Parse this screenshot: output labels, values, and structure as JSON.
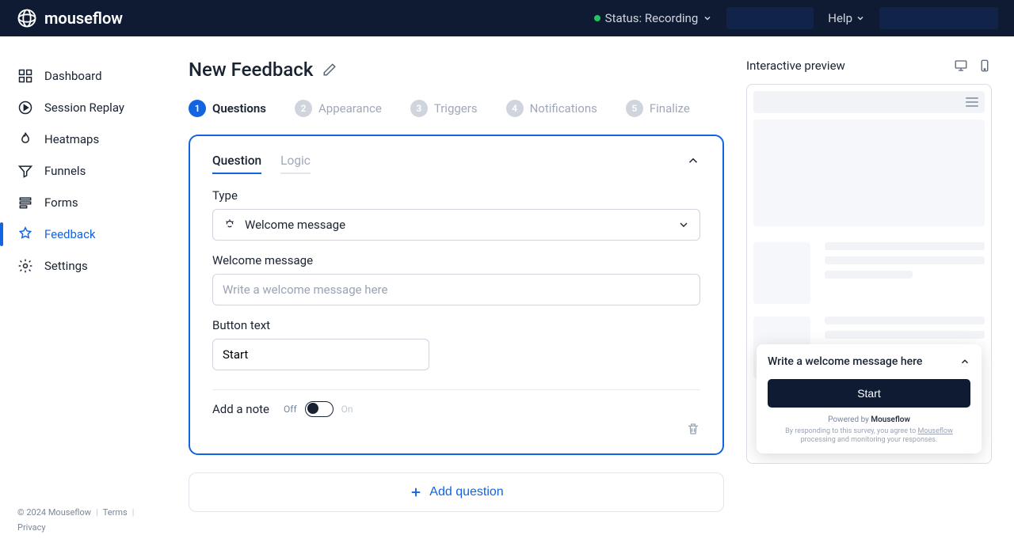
{
  "brand": "mouseflow",
  "topbar": {
    "status_label": "Status: Recording",
    "help_label": "Help"
  },
  "sidebar": {
    "items": [
      {
        "label": "Dashboard"
      },
      {
        "label": "Session Replay"
      },
      {
        "label": "Heatmaps"
      },
      {
        "label": "Funnels"
      },
      {
        "label": "Forms"
      },
      {
        "label": "Feedback"
      },
      {
        "label": "Settings"
      }
    ],
    "footer": {
      "copyright": "© 2024 Mouseflow",
      "terms": "Terms",
      "privacy": "Privacy"
    }
  },
  "page": {
    "title": "New Feedback",
    "steps": [
      {
        "num": "1",
        "label": "Questions"
      },
      {
        "num": "2",
        "label": "Appearance"
      },
      {
        "num": "3",
        "label": "Triggers"
      },
      {
        "num": "4",
        "label": "Notifications"
      },
      {
        "num": "5",
        "label": "Finalize"
      }
    ]
  },
  "card": {
    "tabs": {
      "question": "Question",
      "logic": "Logic"
    },
    "type_label": "Type",
    "type_value": "Welcome message",
    "welcome_label": "Welcome message",
    "welcome_placeholder": "Write a welcome message here",
    "button_label": "Button text",
    "button_value": "Start",
    "note_label": "Add a note",
    "toggle_off": "Off",
    "toggle_on": "On"
  },
  "add_question_label": "Add question",
  "preview": {
    "title": "Interactive preview",
    "popup_title": "Write a welcome message here",
    "popup_button": "Start",
    "powered_prefix": "Powered by ",
    "powered_brand": "Mouseflow",
    "disclaimer_prefix": "By responding to this survey, you agree to ",
    "disclaimer_link": "Mouseflow",
    "disclaimer_suffix": " processing and monitoring your responses."
  }
}
